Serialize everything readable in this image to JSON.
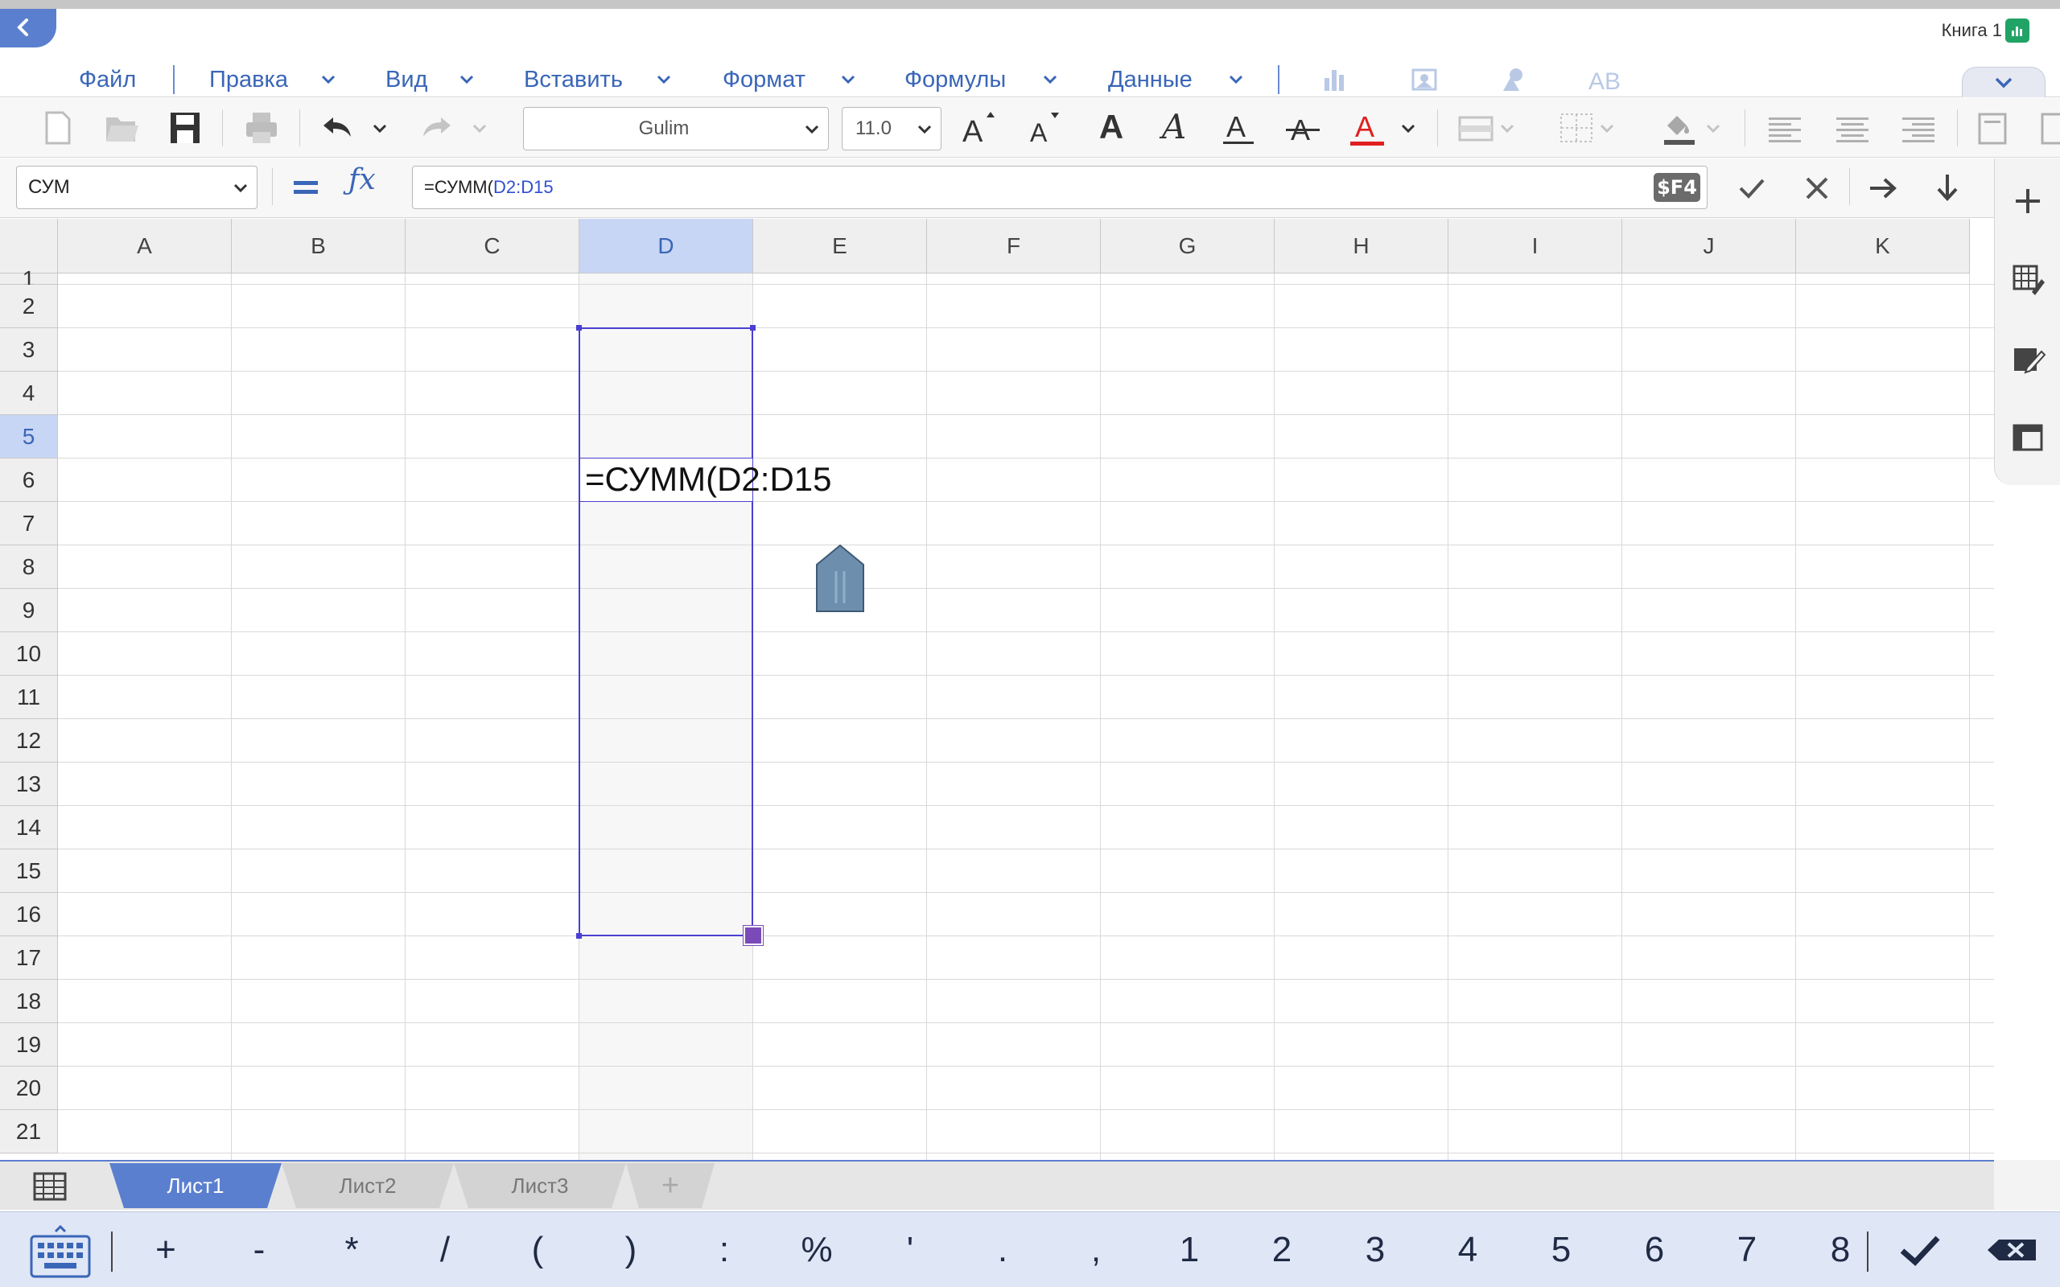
{
  "window": {
    "doc_title": "Книга 1"
  },
  "menu": {
    "items": [
      {
        "label": "Файл"
      },
      {
        "label": "Правка"
      },
      {
        "label": "Вид"
      },
      {
        "label": "Вставить"
      },
      {
        "label": "Формат"
      },
      {
        "label": "Формулы"
      },
      {
        "label": "Данные"
      }
    ]
  },
  "toolbar": {
    "font_name": "Gulim",
    "font_size": "11.0",
    "font_color": "#e02020"
  },
  "formula_bar": {
    "name_box": "СУМ",
    "formula_prefix": "=СУММ(",
    "formula_ref": "D2:D15",
    "f4_label": "$F4"
  },
  "grid": {
    "columns": [
      "A",
      "B",
      "C",
      "D",
      "E",
      "F",
      "G",
      "H",
      "I",
      "J",
      "K"
    ],
    "selected_column": "D",
    "rows": [
      "1",
      "2",
      "3",
      "4",
      "5",
      "6",
      "7",
      "8",
      "9",
      "10",
      "11",
      "12",
      "13",
      "14",
      "15",
      "16",
      "17",
      "18",
      "19",
      "20",
      "21"
    ],
    "selected_row": "5",
    "editing_cell_text": "=СУММ(D2:D15",
    "range_color": "#4a3fd1"
  },
  "sheets": {
    "tabs": [
      {
        "label": "Лист1",
        "active": true
      },
      {
        "label": "Лист2",
        "active": false
      },
      {
        "label": "Лист3",
        "active": false
      }
    ],
    "add_label": "+"
  },
  "keyboard": {
    "keys": [
      "+",
      "-",
      "*",
      "/",
      "(",
      ")",
      ":",
      "%",
      "'",
      ".",
      ",",
      "1",
      "2",
      "3",
      "4",
      "5",
      "6",
      "7",
      "8"
    ]
  }
}
